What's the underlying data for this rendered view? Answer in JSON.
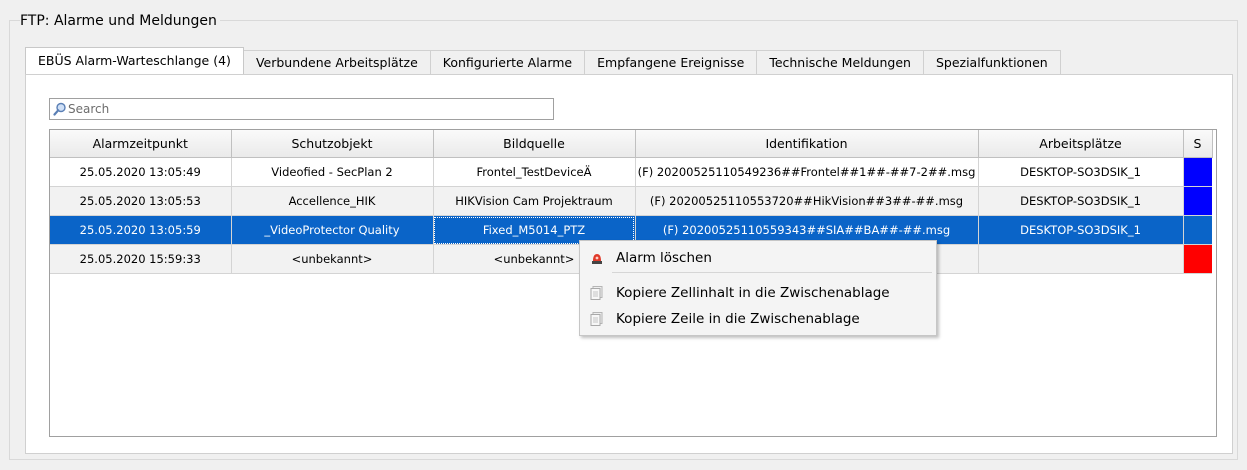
{
  "group": {
    "title": "FTP: Alarme und Meldungen"
  },
  "tabs": [
    {
      "label": "EBÜS Alarm-Warteschlange (4)",
      "active": true
    },
    {
      "label": "Verbundene Arbeitsplätze"
    },
    {
      "label": "Konfigurierte Alarme"
    },
    {
      "label": "Empfangene Ereignisse"
    },
    {
      "label": "Technische Meldungen"
    },
    {
      "label": "Spezialfunktionen"
    }
  ],
  "search": {
    "placeholder": "Search",
    "value": ""
  },
  "table": {
    "columns": [
      "Alarmzeitpunkt",
      "Schutzobjekt",
      "Bildquelle",
      "Identifikation",
      "Arbeitsplätze",
      "S"
    ],
    "rows": [
      {
        "time": "25.05.2020 13:05:49",
        "object": "Videofied - SecPlan 2",
        "source": "Frontel_TestDeviceÄ",
        "id": "(F) 20200525110549236##Frontel##1##-##7-2##.msg",
        "workplace": "DESKTOP-SO3DSIK_1",
        "status_color": "#0000ff"
      },
      {
        "time": "25.05.2020 13:05:53",
        "object": "Accellence_HIK",
        "source": "HIKVision Cam Projektraum",
        "id": "(F) 20200525110553720##HikVision##3##-##.msg",
        "workplace": "DESKTOP-SO3DSIK_1",
        "status_color": "#0000ff"
      },
      {
        "time": "25.05.2020 13:05:59",
        "object": "_VideoProtector Quality",
        "source": "Fixed_M5014_PTZ",
        "id": "(F) 20200525110559343##SIA##BA##-##.msg",
        "workplace": "DESKTOP-SO3DSIK_1",
        "status_color": "#0a64c8",
        "selected": true
      },
      {
        "time": "25.05.2020 15:59:33",
        "object": "<unbekannt>",
        "source": "<unbekannt>",
        "id": "",
        "workplace": "",
        "status_color": "#ff0000"
      }
    ]
  },
  "context_menu": {
    "items": [
      {
        "label": "Alarm löschen",
        "icon": "alarm-siren-icon"
      },
      {
        "label": "Kopiere Zellinhalt in die Zwischenablage",
        "icon": "copy-icon"
      },
      {
        "label": "Kopiere Zeile in die Zwischenablage",
        "icon": "copy-icon"
      }
    ]
  }
}
